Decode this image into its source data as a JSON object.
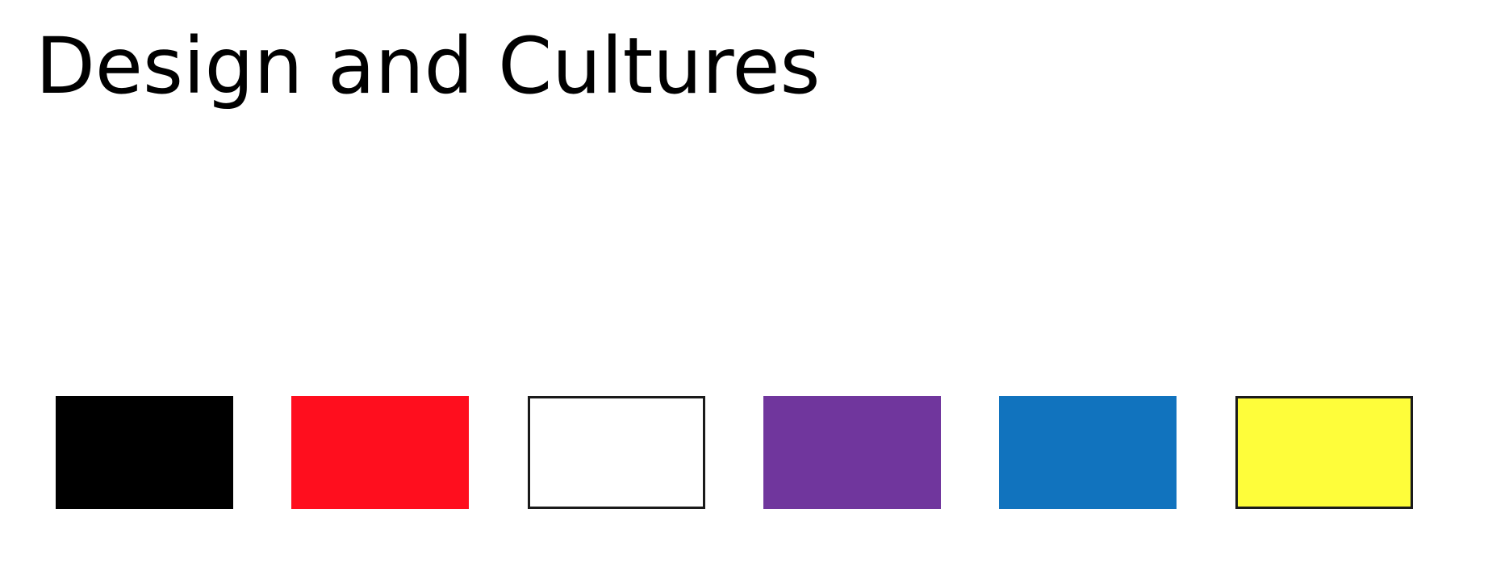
{
  "slide": {
    "title": "Design and Cultures"
  },
  "swatches": [
    {
      "color": "#000000",
      "outlined": false
    },
    {
      "color": "#ff0e1e",
      "outlined": false
    },
    {
      "color": "#ffffff",
      "outlined": true
    },
    {
      "color": "#70369d",
      "outlined": false
    },
    {
      "color": "#1173be",
      "outlined": false
    },
    {
      "color": "#fefd3a",
      "outlined": true
    }
  ]
}
